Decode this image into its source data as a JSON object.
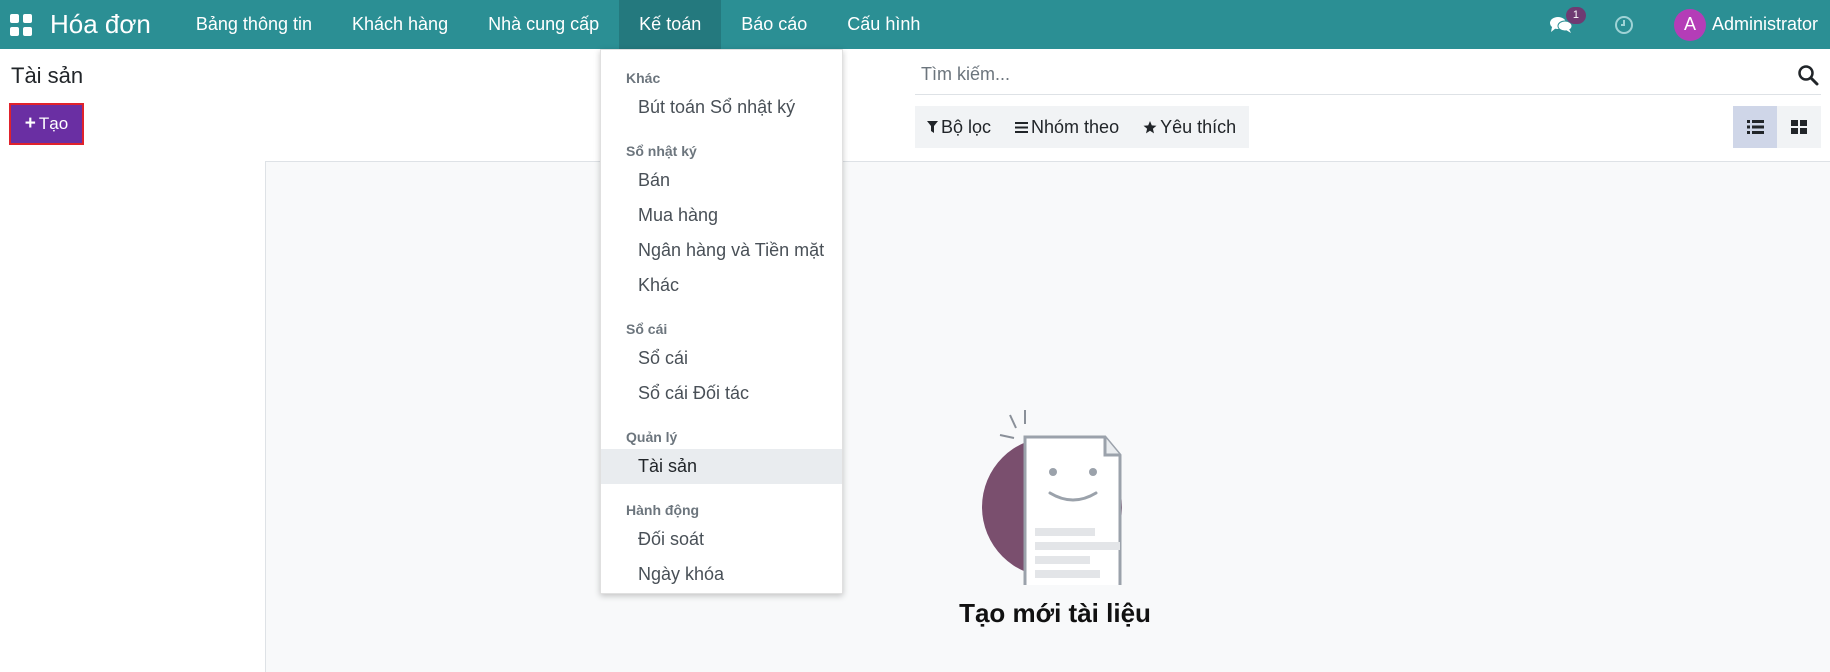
{
  "navbar": {
    "brand": "Hóa đơn",
    "menu": [
      {
        "label": "Bảng thông tin"
      },
      {
        "label": "Khách hàng"
      },
      {
        "label": "Nhà cung cấp"
      },
      {
        "label": "Kế toán",
        "active": true
      },
      {
        "label": "Báo cáo"
      },
      {
        "label": "Cấu hình"
      }
    ],
    "chat_badge": "1",
    "user_initial": "A",
    "user_name": "Administrator",
    "colors": {
      "bar": "#2b8f94",
      "avatar": "#b43db7"
    }
  },
  "control_panel": {
    "title": "Tài sản",
    "create_label": "Tạo",
    "search_placeholder": "Tìm kiếm...",
    "filters": {
      "filter": "Bộ lọc",
      "group_by": "Nhóm theo",
      "favorites": "Yêu thích"
    },
    "views": [
      {
        "icon": "list-view-icon",
        "active": true
      },
      {
        "icon": "kanban-view-icon",
        "active": false
      }
    ]
  },
  "dropdown": {
    "sections": [
      {
        "header": "Khác",
        "items": [
          "Bút toán Sổ nhật ký"
        ]
      },
      {
        "header": "Sổ nhật ký",
        "items": [
          "Bán",
          "Mua hàng",
          "Ngân hàng và Tiền mặt",
          "Khác"
        ]
      },
      {
        "header": "Sổ cái",
        "items": [
          "Sổ cái",
          "Sổ cái Đối tác"
        ]
      },
      {
        "header": "Quản lý",
        "items": [
          "Tài sản"
        ]
      },
      {
        "header": "Hành động",
        "items": [
          "Đối soát",
          "Ngày khóa"
        ]
      }
    ],
    "active_item": "Tài sản"
  },
  "empty_state": {
    "title": "Tạo mới tài liệu"
  }
}
